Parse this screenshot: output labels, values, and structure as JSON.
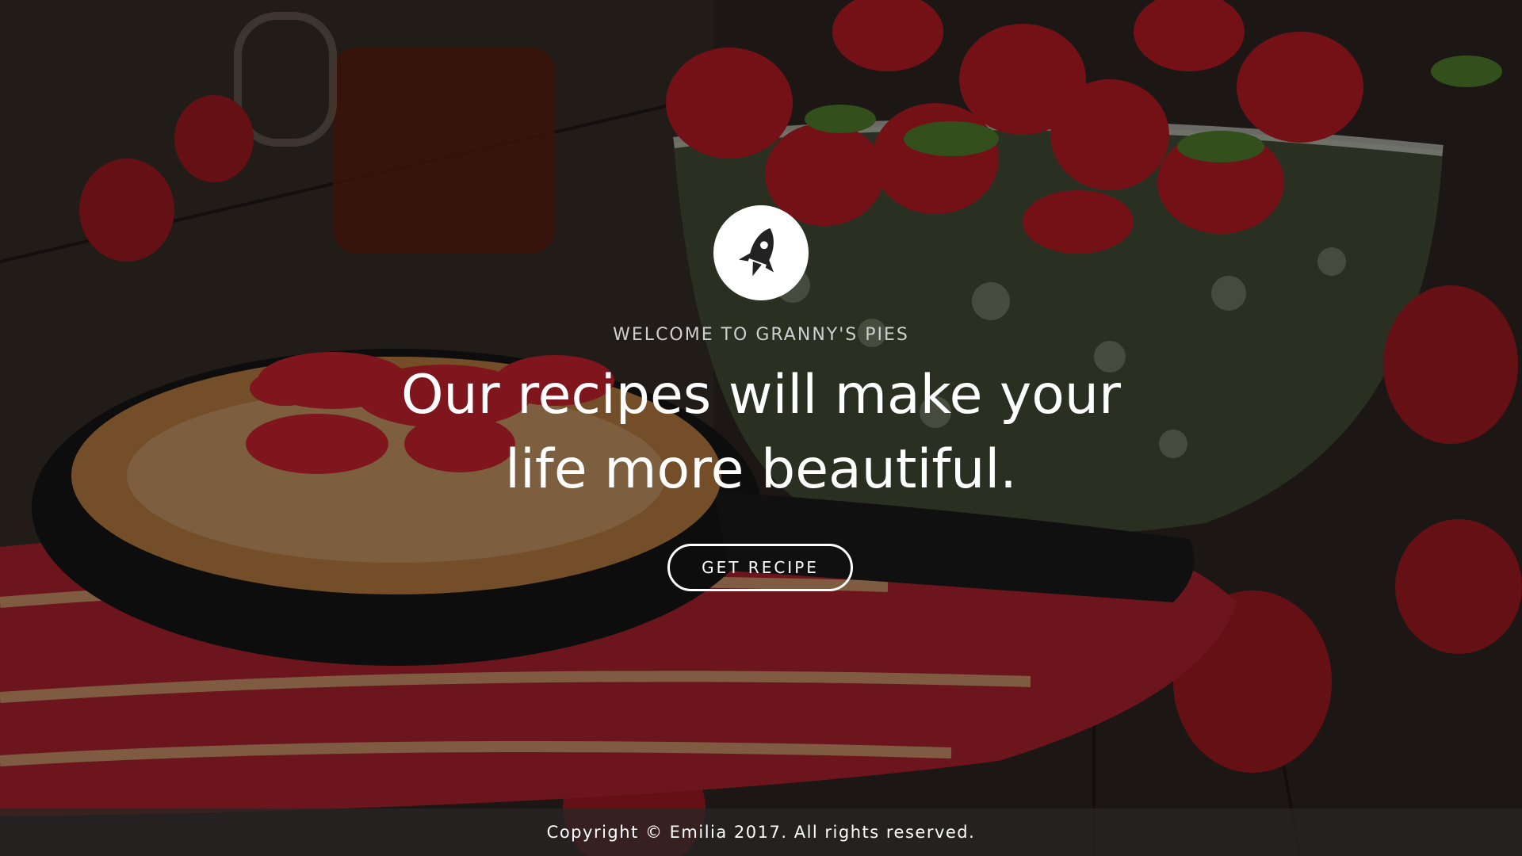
{
  "hero": {
    "logo_icon": "rocket-icon",
    "subtitle": "WELCOME TO GRANNY'S PIES",
    "headline_line1": "Our recipes will make your",
    "headline_line2": "life more beautiful.",
    "cta_label": "GET RECIPE"
  },
  "footer": {
    "copyright": "Copyright © Emilia 2017. All rights reserved."
  },
  "colors": {
    "text": "#ffffff",
    "subtitle": "#cfcfcf",
    "logo_bg": "#ffffff",
    "logo_icon": "#222222",
    "footer_bg": "#282624"
  }
}
